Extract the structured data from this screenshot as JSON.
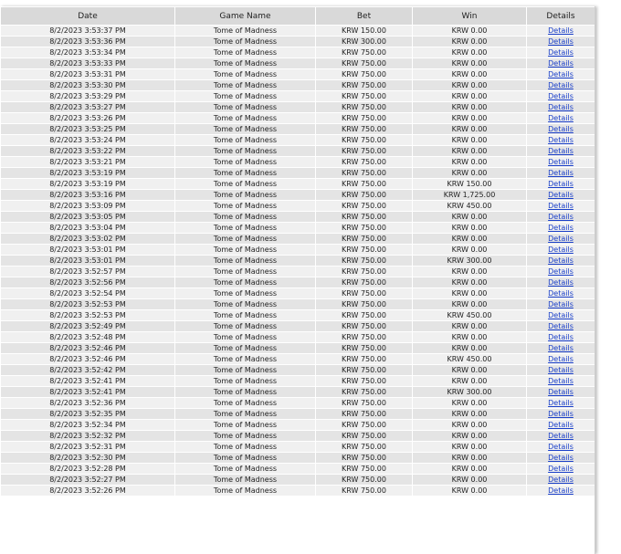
{
  "headers": {
    "date": "Date",
    "game": "Game Name",
    "bet": "Bet",
    "win": "Win",
    "details": "Details"
  },
  "link_color": "#1a3fc9",
  "rows": [
    {
      "date": "8/2/2023 3:53:37 PM",
      "game": "Tome of Madness",
      "bet": "KRW 150.00",
      "win": "KRW 0.00",
      "details": "Details"
    },
    {
      "date": "8/2/2023 3:53:36 PM",
      "game": "Tome of Madness",
      "bet": "KRW 300.00",
      "win": "KRW 0.00",
      "details": "Details"
    },
    {
      "date": "8/2/2023 3:53:34 PM",
      "game": "Tome of Madness",
      "bet": "KRW 750.00",
      "win": "KRW 0.00",
      "details": "Details"
    },
    {
      "date": "8/2/2023 3:53:33 PM",
      "game": "Tome of Madness",
      "bet": "KRW 750.00",
      "win": "KRW 0.00",
      "details": "Details"
    },
    {
      "date": "8/2/2023 3:53:31 PM",
      "game": "Tome of Madness",
      "bet": "KRW 750.00",
      "win": "KRW 0.00",
      "details": "Details"
    },
    {
      "date": "8/2/2023 3:53:30 PM",
      "game": "Tome of Madness",
      "bet": "KRW 750.00",
      "win": "KRW 0.00",
      "details": "Details"
    },
    {
      "date": "8/2/2023 3:53:29 PM",
      "game": "Tome of Madness",
      "bet": "KRW 750.00",
      "win": "KRW 0.00",
      "details": "Details"
    },
    {
      "date": "8/2/2023 3:53:27 PM",
      "game": "Tome of Madness",
      "bet": "KRW 750.00",
      "win": "KRW 0.00",
      "details": "Details"
    },
    {
      "date": "8/2/2023 3:53:26 PM",
      "game": "Tome of Madness",
      "bet": "KRW 750.00",
      "win": "KRW 0.00",
      "details": "Details"
    },
    {
      "date": "8/2/2023 3:53:25 PM",
      "game": "Tome of Madness",
      "bet": "KRW 750.00",
      "win": "KRW 0.00",
      "details": "Details"
    },
    {
      "date": "8/2/2023 3:53:24 PM",
      "game": "Tome of Madness",
      "bet": "KRW 750.00",
      "win": "KRW 0.00",
      "details": "Details"
    },
    {
      "date": "8/2/2023 3:53:22 PM",
      "game": "Tome of Madness",
      "bet": "KRW 750.00",
      "win": "KRW 0.00",
      "details": "Details"
    },
    {
      "date": "8/2/2023 3:53:21 PM",
      "game": "Tome of Madness",
      "bet": "KRW 750.00",
      "win": "KRW 0.00",
      "details": "Details"
    },
    {
      "date": "8/2/2023 3:53:19 PM",
      "game": "Tome of Madness",
      "bet": "KRW 750.00",
      "win": "KRW 0.00",
      "details": "Details"
    },
    {
      "date": "8/2/2023 3:53:19 PM",
      "game": "Tome of Madness",
      "bet": "KRW 750.00",
      "win": "KRW 150.00",
      "details": "Details"
    },
    {
      "date": "8/2/2023 3:53:16 PM",
      "game": "Tome of Madness",
      "bet": "KRW 750.00",
      "win": "KRW 1,725.00",
      "details": "Details"
    },
    {
      "date": "8/2/2023 3:53:09 PM",
      "game": "Tome of Madness",
      "bet": "KRW 750.00",
      "win": "KRW 450.00",
      "details": "Details"
    },
    {
      "date": "8/2/2023 3:53:05 PM",
      "game": "Tome of Madness",
      "bet": "KRW 750.00",
      "win": "KRW 0.00",
      "details": "Details"
    },
    {
      "date": "8/2/2023 3:53:04 PM",
      "game": "Tome of Madness",
      "bet": "KRW 750.00",
      "win": "KRW 0.00",
      "details": "Details"
    },
    {
      "date": "8/2/2023 3:53:02 PM",
      "game": "Tome of Madness",
      "bet": "KRW 750.00",
      "win": "KRW 0.00",
      "details": "Details"
    },
    {
      "date": "8/2/2023 3:53:01 PM",
      "game": "Tome of Madness",
      "bet": "KRW 750.00",
      "win": "KRW 0.00",
      "details": "Details"
    },
    {
      "date": "8/2/2023 3:53:01 PM",
      "game": "Tome of Madness",
      "bet": "KRW 750.00",
      "win": "KRW 300.00",
      "details": "Details"
    },
    {
      "date": "8/2/2023 3:52:57 PM",
      "game": "Tome of Madness",
      "bet": "KRW 750.00",
      "win": "KRW 0.00",
      "details": "Details"
    },
    {
      "date": "8/2/2023 3:52:56 PM",
      "game": "Tome of Madness",
      "bet": "KRW 750.00",
      "win": "KRW 0.00",
      "details": "Details"
    },
    {
      "date": "8/2/2023 3:52:54 PM",
      "game": "Tome of Madness",
      "bet": "KRW 750.00",
      "win": "KRW 0.00",
      "details": "Details"
    },
    {
      "date": "8/2/2023 3:52:53 PM",
      "game": "Tome of Madness",
      "bet": "KRW 750.00",
      "win": "KRW 0.00",
      "details": "Details"
    },
    {
      "date": "8/2/2023 3:52:53 PM",
      "game": "Tome of Madness",
      "bet": "KRW 750.00",
      "win": "KRW 450.00",
      "details": "Details"
    },
    {
      "date": "8/2/2023 3:52:49 PM",
      "game": "Tome of Madness",
      "bet": "KRW 750.00",
      "win": "KRW 0.00",
      "details": "Details"
    },
    {
      "date": "8/2/2023 3:52:48 PM",
      "game": "Tome of Madness",
      "bet": "KRW 750.00",
      "win": "KRW 0.00",
      "details": "Details"
    },
    {
      "date": "8/2/2023 3:52:46 PM",
      "game": "Tome of Madness",
      "bet": "KRW 750.00",
      "win": "KRW 0.00",
      "details": "Details"
    },
    {
      "date": "8/2/2023 3:52:46 PM",
      "game": "Tome of Madness",
      "bet": "KRW 750.00",
      "win": "KRW 450.00",
      "details": "Details"
    },
    {
      "date": "8/2/2023 3:52:42 PM",
      "game": "Tome of Madness",
      "bet": "KRW 750.00",
      "win": "KRW 0.00",
      "details": "Details"
    },
    {
      "date": "8/2/2023 3:52:41 PM",
      "game": "Tome of Madness",
      "bet": "KRW 750.00",
      "win": "KRW 0.00",
      "details": "Details"
    },
    {
      "date": "8/2/2023 3:52:41 PM",
      "game": "Tome of Madness",
      "bet": "KRW 750.00",
      "win": "KRW 300.00",
      "details": "Details"
    },
    {
      "date": "8/2/2023 3:52:36 PM",
      "game": "Tome of Madness",
      "bet": "KRW 750.00",
      "win": "KRW 0.00",
      "details": "Details"
    },
    {
      "date": "8/2/2023 3:52:35 PM",
      "game": "Tome of Madness",
      "bet": "KRW 750.00",
      "win": "KRW 0.00",
      "details": "Details"
    },
    {
      "date": "8/2/2023 3:52:34 PM",
      "game": "Tome of Madness",
      "bet": "KRW 750.00",
      "win": "KRW 0.00",
      "details": "Details"
    },
    {
      "date": "8/2/2023 3:52:32 PM",
      "game": "Tome of Madness",
      "bet": "KRW 750.00",
      "win": "KRW 0.00",
      "details": "Details"
    },
    {
      "date": "8/2/2023 3:52:31 PM",
      "game": "Tome of Madness",
      "bet": "KRW 750.00",
      "win": "KRW 0.00",
      "details": "Details"
    },
    {
      "date": "8/2/2023 3:52:30 PM",
      "game": "Tome of Madness",
      "bet": "KRW 750.00",
      "win": "KRW 0.00",
      "details": "Details"
    },
    {
      "date": "8/2/2023 3:52:28 PM",
      "game": "Tome of Madness",
      "bet": "KRW 750.00",
      "win": "KRW 0.00",
      "details": "Details"
    },
    {
      "date": "8/2/2023 3:52:27 PM",
      "game": "Tome of Madness",
      "bet": "KRW 750.00",
      "win": "KRW 0.00",
      "details": "Details"
    },
    {
      "date": "8/2/2023 3:52:26 PM",
      "game": "Tome of Madness",
      "bet": "KRW 750.00",
      "win": "KRW 0.00",
      "details": "Details"
    }
  ]
}
